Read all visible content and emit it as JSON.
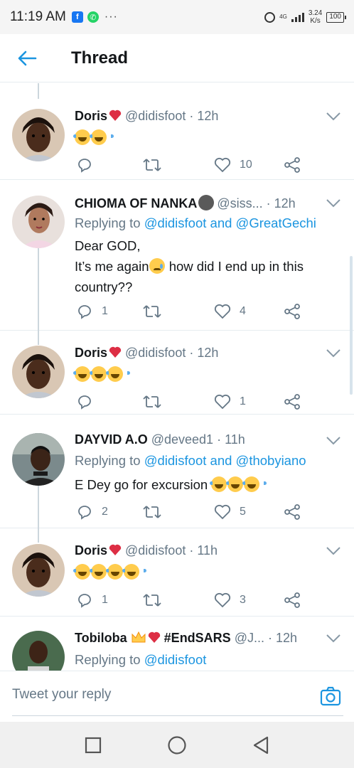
{
  "status_bar": {
    "time": "11:19 AM",
    "network": "4G",
    "speed": "3.24",
    "speed_unit": "K/s",
    "battery": "100",
    "facebook_label": "f",
    "whatsapp_label": "✆",
    "overflow_dots": "···"
  },
  "header": {
    "title": "Thread",
    "back_icon": "arrow-left-icon"
  },
  "tweets": [
    {
      "name": "Doris",
      "handle": "@didisfoot",
      "dot": "·",
      "time": "12h",
      "reply_to_prefix": "",
      "reply_to": "",
      "text": "",
      "emoji_count": 2,
      "reply_count": "",
      "like_count": "10"
    },
    {
      "name": "CHIOMA OF NANKA",
      "handle": "@siss...",
      "dot": "·",
      "time": "12h",
      "reply_to_prefix": "Replying to",
      "reply_to": "@didisfoot and @GreatGechi",
      "text_line1": "Dear GOD,",
      "text_line2a": "It’s me again",
      "text_line2b": " how did I end up in this",
      "text_line3": "country??",
      "reply_count": "1",
      "like_count": "4"
    },
    {
      "name": "Doris",
      "handle": "@didisfoot",
      "dot": "·",
      "time": "12h",
      "emoji_count": 3,
      "reply_count": "",
      "like_count": "1"
    },
    {
      "name": "DAYVID A.O",
      "handle": "@deveed1",
      "dot": "·",
      "time": "11h",
      "reply_to_prefix": "Replying to",
      "reply_to": "@didisfoot and @thobyiano",
      "text": "E Dey go for excursion ",
      "reply_count": "2",
      "like_count": "5"
    },
    {
      "name": "Doris",
      "handle": "@didisfoot",
      "dot": "·",
      "time": "11h",
      "emoji_count": 4,
      "reply_count": "1",
      "like_count": "3"
    },
    {
      "name": "Tobiloba",
      "name_tag": "#EndSARS",
      "handle": "@J...",
      "dot": "·",
      "time": "12h",
      "reply_to_prefix": "Replying to",
      "reply_to": "@didisfoot"
    }
  ],
  "reply_bar": {
    "placeholder": "Tweet your reply"
  },
  "colors": {
    "accent": "#1b95e0",
    "text_primary": "#14171a",
    "text_secondary": "#657786",
    "heart": "#e0245e",
    "divider": "#e6ecf0"
  }
}
